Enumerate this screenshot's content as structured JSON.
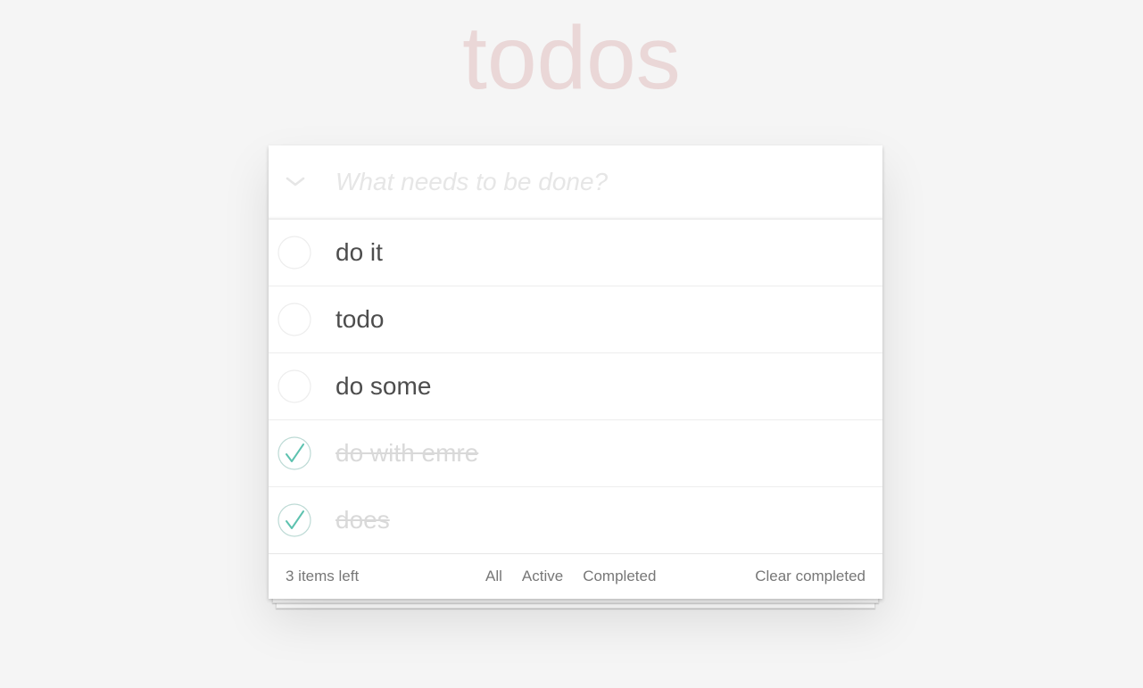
{
  "app": {
    "title": "todos"
  },
  "new_todo": {
    "placeholder": "What needs to be done?",
    "value": ""
  },
  "toggle_all": {
    "icon": "chevron-down-icon"
  },
  "todos": [
    {
      "label": "do it",
      "completed": false
    },
    {
      "label": "todo",
      "completed": false
    },
    {
      "label": "do some",
      "completed": false
    },
    {
      "label": "do with emre",
      "completed": true
    },
    {
      "label": "does",
      "completed": true
    }
  ],
  "footer": {
    "count_text": "3 items left",
    "filters": [
      {
        "label": "All"
      },
      {
        "label": "Active"
      },
      {
        "label": "Completed"
      }
    ],
    "clear_label": "Clear completed"
  },
  "colors": {
    "background": "#f5f5f5",
    "title": "#ead7d7",
    "check_accent": "#5dc2af",
    "text": "#4d4d4d",
    "completed_text": "#d9d9d9"
  }
}
